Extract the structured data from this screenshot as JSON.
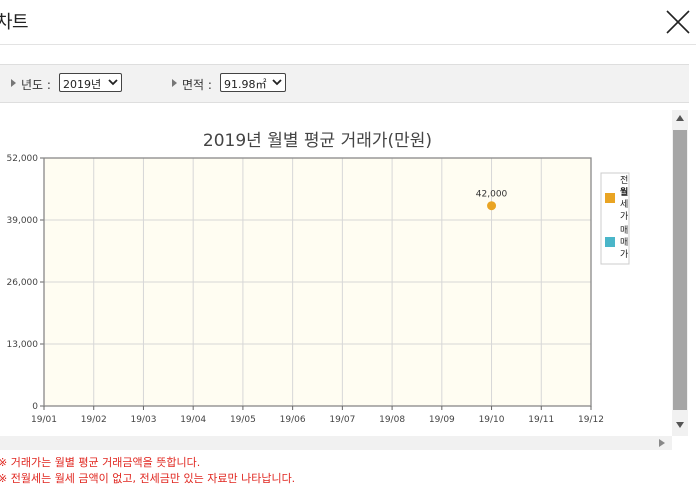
{
  "header": {
    "title": "차트"
  },
  "filters": {
    "year_label": "년도 :",
    "year_value": "2019년",
    "area_label": "면적 :",
    "area_value": "91.98㎡"
  },
  "chart_data": {
    "type": "line",
    "title": "2019년 월별 평균 거래가(만원)",
    "categories": [
      "19/01",
      "19/02",
      "19/03",
      "19/04",
      "19/05",
      "19/06",
      "19/07",
      "19/08",
      "19/09",
      "19/10",
      "19/11",
      "19/12"
    ],
    "y_ticks": [
      "0",
      "13,000",
      "26,000",
      "39,000",
      "52,000"
    ],
    "ylim": [
      0,
      52000
    ],
    "series": [
      {
        "name": "전월세가",
        "color": "#e9a423",
        "values": [
          null,
          null,
          null,
          null,
          null,
          null,
          null,
          null,
          null,
          42000,
          null,
          null
        ],
        "labels": [
          "",
          "",
          "",
          "",
          "",
          "",
          "",
          "",
          "",
          "42,000",
          "",
          ""
        ]
      },
      {
        "name": "매매가",
        "color": "#4ab6c9",
        "values": [
          null,
          null,
          null,
          null,
          null,
          null,
          null,
          null,
          null,
          null,
          null,
          null
        ]
      }
    ],
    "legend_position": "right",
    "grid": true
  },
  "legend_lines": {
    "series1": [
      "전",
      "월",
      "세",
      "가"
    ],
    "series2": [
      "매",
      "매",
      "가"
    ]
  },
  "notes": [
    "※ 거래가는 월별 평균 거래금액을 뜻합니다.",
    "※ 전월세는 월세 금액이 없고, 전세금만 있는 자료만 나타납니다."
  ]
}
